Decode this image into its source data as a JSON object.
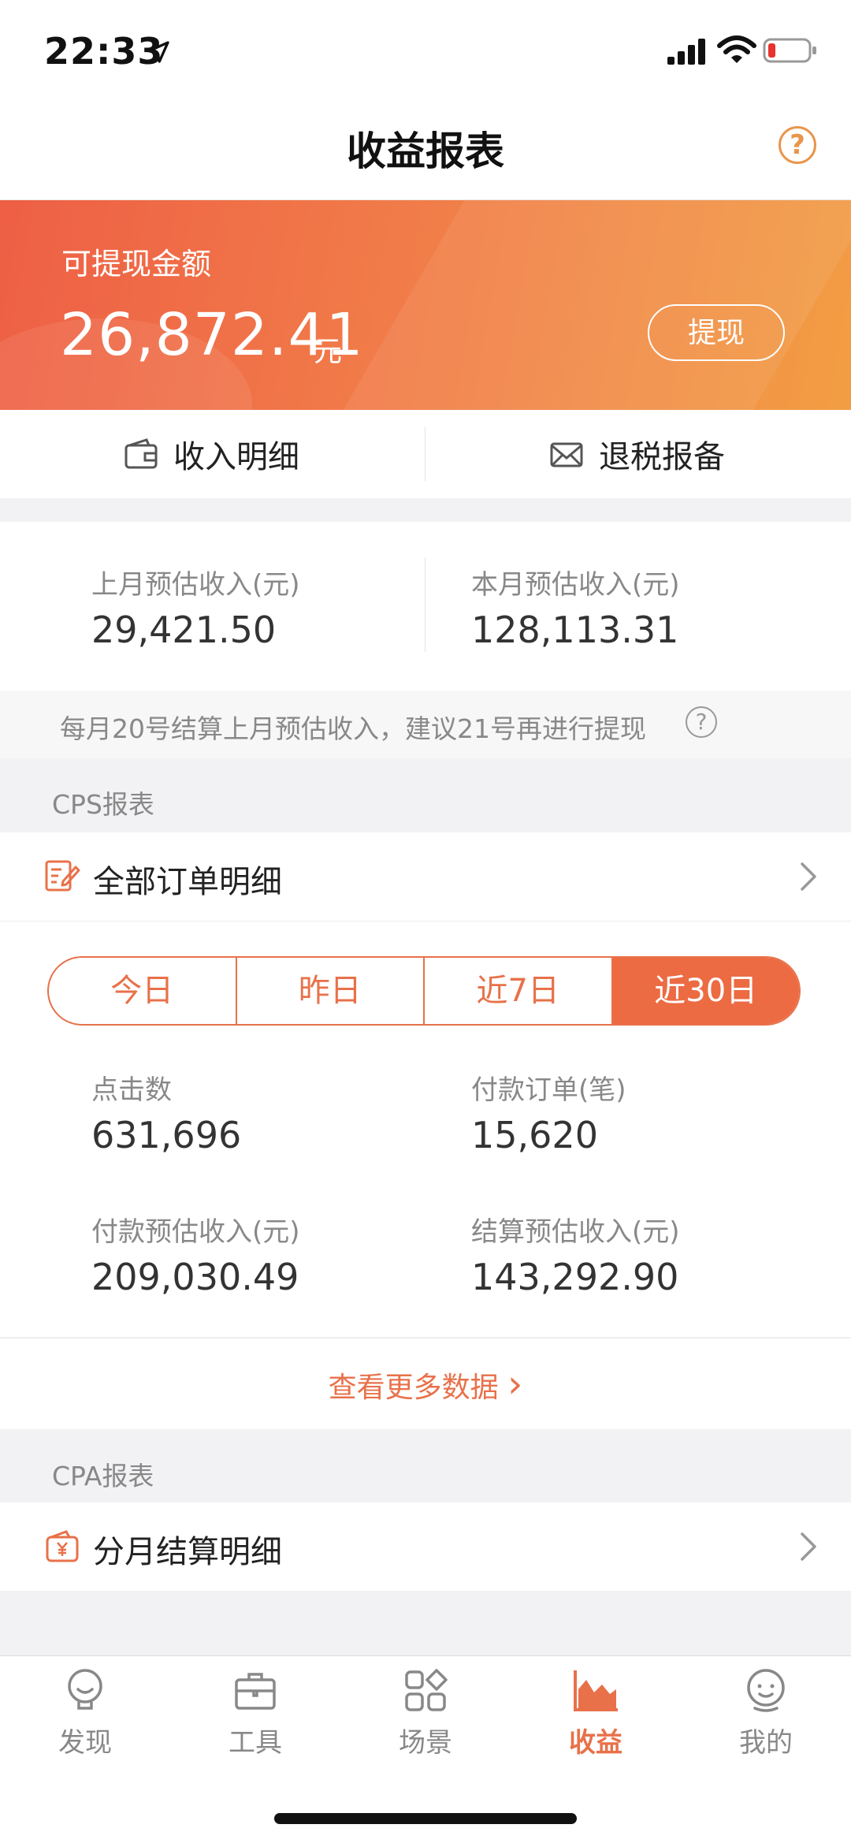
{
  "status_bar": {
    "time": "22:33"
  },
  "header": {
    "title": "收益报表",
    "help_symbol": "?"
  },
  "balance": {
    "label": "可提现金额",
    "amount": "26,872.41",
    "unit": "元",
    "withdraw_label": "提现"
  },
  "quick_links": [
    {
      "label": "收入明细",
      "icon": "wallet-icon"
    },
    {
      "label": "退税报备",
      "icon": "envelope-icon"
    }
  ],
  "estimates": {
    "last_month": {
      "label": "上月预估收入(元)",
      "value": "29,421.50"
    },
    "this_month": {
      "label": "本月预估收入(元)",
      "value": "128,113.31"
    }
  },
  "notice": {
    "text": "每月20号结算上月预估收入，建议21号再进行提现",
    "help_symbol": "?"
  },
  "cps": {
    "section_label": "CPS报表",
    "row_label": "全部订单明细",
    "tabs": [
      {
        "label": "今日"
      },
      {
        "label": "昨日"
      },
      {
        "label": "近7日"
      },
      {
        "label": "近30日"
      }
    ],
    "active_tab": "近30日",
    "stats": [
      {
        "label": "点击数",
        "value": "631,696"
      },
      {
        "label": "付款订单(笔)",
        "value": "15,620"
      },
      {
        "label": "付款预估收入(元)",
        "value": "209,030.49"
      },
      {
        "label": "结算预估收入(元)",
        "value": "143,292.90"
      }
    ],
    "more_label": "查看更多数据",
    "more_arrow": "›"
  },
  "cpa": {
    "section_label": "CPA报表",
    "row_label": "分月结算明细"
  },
  "tab_bar": {
    "items": [
      {
        "label": "发现",
        "icon": "bulb-icon"
      },
      {
        "label": "工具",
        "icon": "briefcase-icon"
      },
      {
        "label": "场景",
        "icon": "grid-icon"
      },
      {
        "label": "收益",
        "icon": "chart-icon"
      },
      {
        "label": "我的",
        "icon": "profile-icon"
      }
    ],
    "active": "收益"
  },
  "colors": {
    "accent": "#e8714a",
    "banner_start": "#ee5f45",
    "banner_end": "#f29d44"
  }
}
